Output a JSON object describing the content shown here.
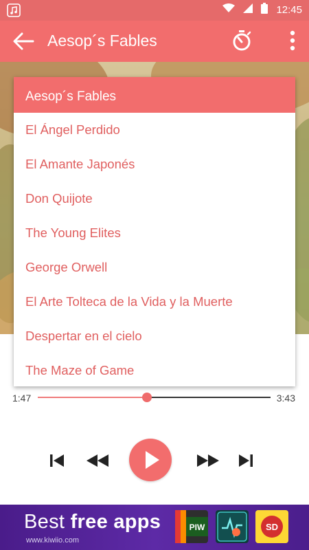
{
  "status_bar": {
    "time": "12:45"
  },
  "app_bar": {
    "title": "Aesop´s Fables"
  },
  "playlist": {
    "header": "Aesop´s Fables",
    "items": [
      "El Ángel Perdido",
      "El Amante Japonés",
      "Don Quijote",
      "The Young Elites",
      "George Orwell",
      "El Arte Tolteca de la Vida y la Muerte",
      "Despertar en el cielo",
      "The Maze of Game"
    ]
  },
  "player": {
    "elapsed": "1:47",
    "total": "3:43",
    "progress": 0.47
  },
  "ad": {
    "headline_light": "Best ",
    "headline_bold": "free apps",
    "url": "www.kiwiio.com",
    "apps": [
      "PIW",
      "",
      "SD"
    ]
  },
  "colors": {
    "accent": "#f26d6d",
    "status_bar": "#e56a6a",
    "item_text": "#e05f5f",
    "ad_background": "#4a1c8a"
  }
}
